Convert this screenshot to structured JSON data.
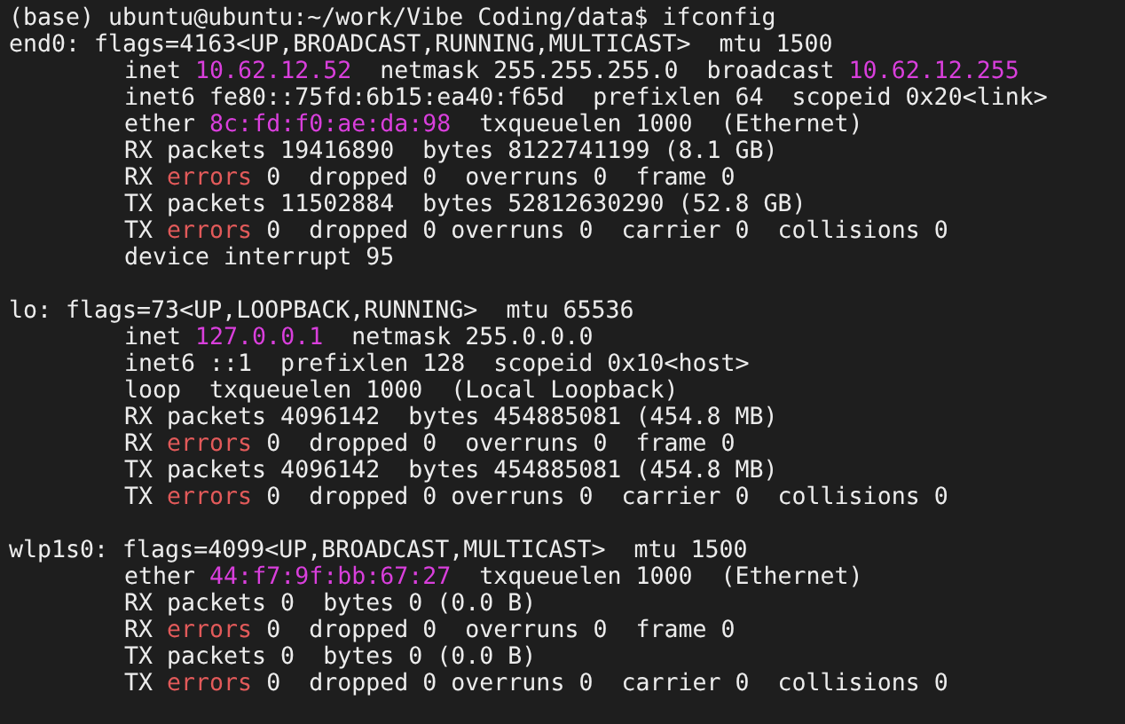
{
  "prompt": "(base) ubuntu@ubuntu:~/work/Vibe Coding/data$ ifconfig",
  "interfaces": [
    {
      "header": "end0: flags=4163<UP,BROADCAST,RUNNING,MULTICAST>  mtu 1500",
      "lines": [
        [
          {
            "kind": "plain",
            "text": "inet "
          },
          {
            "kind": "address",
            "text": "10.62.12.52"
          },
          {
            "kind": "plain",
            "text": "  netmask 255.255.255.0  broadcast "
          },
          {
            "kind": "address",
            "text": "10.62.12.255"
          }
        ],
        [
          {
            "kind": "plain",
            "text": "inet6 fe80::75fd:6b15:ea40:f65d  prefixlen 64  scopeid 0x20<link>"
          }
        ],
        [
          {
            "kind": "plain",
            "text": "ether "
          },
          {
            "kind": "address",
            "text": "8c:fd:f0:ae:da:98"
          },
          {
            "kind": "plain",
            "text": "  txqueuelen 1000  (Ethernet)"
          }
        ],
        [
          {
            "kind": "plain",
            "text": "RX packets 19416890  bytes 8122741199 (8.1 GB)"
          }
        ],
        [
          {
            "kind": "plain",
            "text": "RX "
          },
          {
            "kind": "error",
            "text": "errors"
          },
          {
            "kind": "plain",
            "text": " 0  dropped 0  overruns 0  frame 0"
          }
        ],
        [
          {
            "kind": "plain",
            "text": "TX packets 11502884  bytes 52812630290 (52.8 GB)"
          }
        ],
        [
          {
            "kind": "plain",
            "text": "TX "
          },
          {
            "kind": "error",
            "text": "errors"
          },
          {
            "kind": "plain",
            "text": " 0  dropped 0 overruns 0  carrier 0  collisions 0"
          }
        ],
        [
          {
            "kind": "plain",
            "text": "device interrupt 95"
          }
        ]
      ]
    },
    {
      "header": "lo: flags=73<UP,LOOPBACK,RUNNING>  mtu 65536",
      "lines": [
        [
          {
            "kind": "plain",
            "text": "inet "
          },
          {
            "kind": "address",
            "text": "127.0.0.1"
          },
          {
            "kind": "plain",
            "text": "  netmask 255.0.0.0"
          }
        ],
        [
          {
            "kind": "plain",
            "text": "inet6 ::1  prefixlen 128  scopeid 0x10<host>"
          }
        ],
        [
          {
            "kind": "plain",
            "text": "loop  txqueuelen 1000  (Local Loopback)"
          }
        ],
        [
          {
            "kind": "plain",
            "text": "RX packets 4096142  bytes 454885081 (454.8 MB)"
          }
        ],
        [
          {
            "kind": "plain",
            "text": "RX "
          },
          {
            "kind": "error",
            "text": "errors"
          },
          {
            "kind": "plain",
            "text": " 0  dropped 0  overruns 0  frame 0"
          }
        ],
        [
          {
            "kind": "plain",
            "text": "TX packets 4096142  bytes 454885081 (454.8 MB)"
          }
        ],
        [
          {
            "kind": "plain",
            "text": "TX "
          },
          {
            "kind": "error",
            "text": "errors"
          },
          {
            "kind": "plain",
            "text": " 0  dropped 0 overruns 0  carrier 0  collisions 0"
          }
        ]
      ]
    },
    {
      "header": "wlp1s0: flags=4099<UP,BROADCAST,MULTICAST>  mtu 1500",
      "lines": [
        [
          {
            "kind": "plain",
            "text": "ether "
          },
          {
            "kind": "address",
            "text": "44:f7:9f:bb:67:27"
          },
          {
            "kind": "plain",
            "text": "  txqueuelen 1000  (Ethernet)"
          }
        ],
        [
          {
            "kind": "plain",
            "text": "RX packets 0  bytes 0 (0.0 B)"
          }
        ],
        [
          {
            "kind": "plain",
            "text": "RX "
          },
          {
            "kind": "error",
            "text": "errors"
          },
          {
            "kind": "plain",
            "text": " 0  dropped 0  overruns 0  frame 0"
          }
        ],
        [
          {
            "kind": "plain",
            "text": "TX packets 0  bytes 0 (0.0 B)"
          }
        ],
        [
          {
            "kind": "plain",
            "text": "TX "
          },
          {
            "kind": "error",
            "text": "errors"
          },
          {
            "kind": "plain",
            "text": " 0  dropped 0 overruns 0  carrier 0  collisions 0"
          }
        ]
      ]
    }
  ]
}
